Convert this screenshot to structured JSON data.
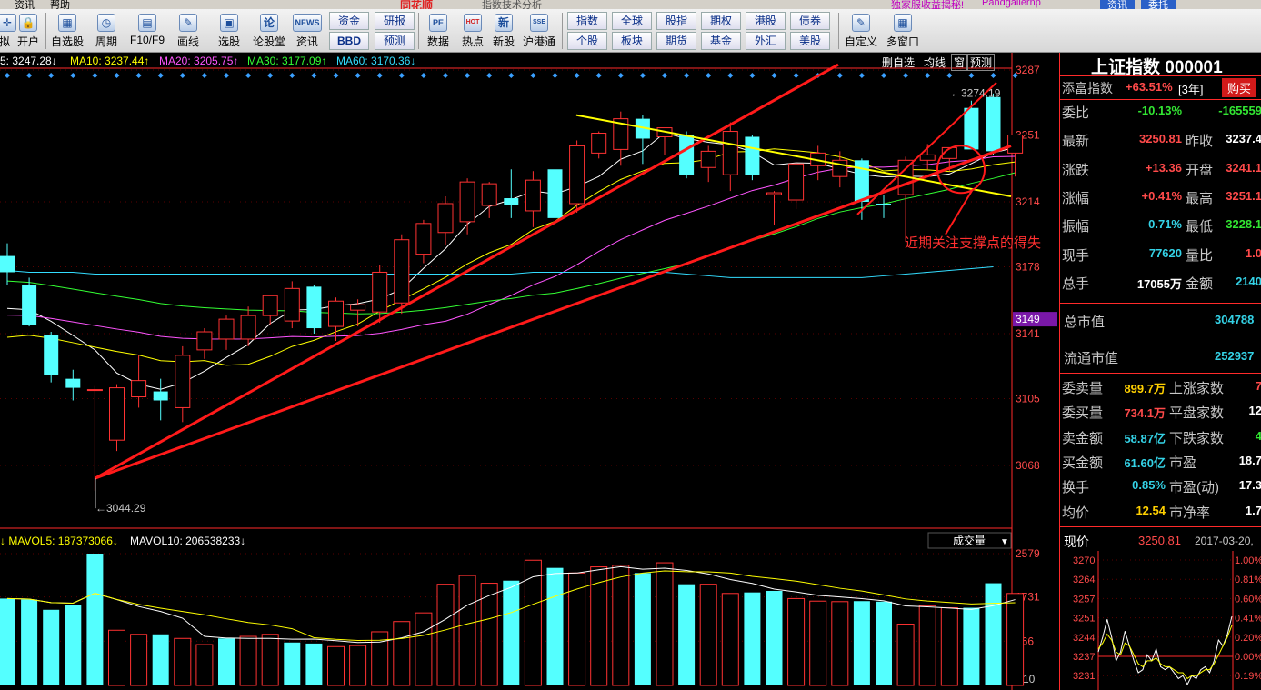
{
  "menubar": {
    "items": [
      "资讯",
      "帮助"
    ],
    "brand": "同花顺",
    "chart_type_label": "指数技术分析",
    "notice_left": "独家服收益揭秘!",
    "notice_right": "Pandgaiiernp",
    "tabs": [
      "资讯",
      "委托"
    ]
  },
  "toolbar": {
    "left": [
      {
        "label": "拟",
        "icon": "crosshair-icon",
        "glyph": "✛"
      },
      {
        "label": "开户",
        "icon": "lock-icon",
        "glyph": "🔒"
      },
      {
        "label": "自选股",
        "icon": "self-select-icon",
        "glyph": "▦"
      },
      {
        "label": "周期",
        "icon": "clock-icon",
        "glyph": "◷"
      },
      {
        "label": "F10/F9",
        "icon": "f10-icon",
        "glyph": "▤"
      },
      {
        "label": "画线",
        "icon": "pencil-icon",
        "glyph": "✎"
      },
      {
        "label": "选股",
        "icon": "stock-pick-icon",
        "glyph": "▣"
      },
      {
        "label": "论股堂",
        "icon": "forum-icon",
        "glyph": "论"
      },
      {
        "label": "资讯",
        "icon": "news-icon",
        "glyph": "NEWS"
      }
    ],
    "buttons_top": [
      "资金",
      "研报"
    ],
    "buttons_bottom": [
      "BBD",
      "预测"
    ],
    "mid": [
      {
        "label": "数据",
        "icon": "pe-icon",
        "glyph": "PE"
      },
      {
        "label": "热点",
        "icon": "hot-icon",
        "glyph": "HOT"
      },
      {
        "label": "新股",
        "icon": "new-stock-icon",
        "glyph": "新"
      },
      {
        "label": "沪港通",
        "icon": "sse-hkex-icon",
        "glyph": "SSE"
      }
    ],
    "market_top": [
      "指数",
      "全球",
      "股指",
      "期权",
      "港股",
      "债券"
    ],
    "market_bottom": [
      "个股",
      "板块",
      "期货",
      "基金",
      "外汇",
      "美股"
    ],
    "right": [
      {
        "label": "自定义",
        "icon": "custom-icon",
        "glyph": "✎"
      },
      {
        "label": "多窗口",
        "icon": "multi-window-icon",
        "glyph": "▦"
      }
    ]
  },
  "ma_bar": [
    {
      "text": "5: 3247.28↓",
      "color": "#ffffff"
    },
    {
      "text": "MA10: 3237.44↑",
      "color": "#ffff00"
    },
    {
      "text": "MA20: 3205.75↑",
      "color": "#ff55ff"
    },
    {
      "text": "MA30: 3177.09↑",
      "color": "#33ff33"
    },
    {
      "text": "MA60: 3170.36↓",
      "color": "#33ddff"
    }
  ],
  "chart_tabs": [
    "删自选",
    "均线",
    "窗",
    "预测"
  ],
  "chart_data": {
    "type": "candlestick",
    "price_axis": {
      "ticks": [
        "3287",
        "3251",
        "3214",
        "3178",
        "3141",
        "3105",
        "3068"
      ],
      "current": "3149"
    },
    "volume_axis": {
      "ticks": [
        "2579",
        "1731",
        "866"
      ],
      "unit": "X10"
    },
    "annotations": {
      "high": "3274.19",
      "low": "3044.29",
      "note": "近期关注支撑点的得失"
    },
    "candles": [
      {
        "o": 3184,
        "h": 3191,
        "l": 3168,
        "c": 3175
      },
      {
        "o": 3168,
        "h": 3172,
        "l": 3145,
        "c": 3146
      },
      {
        "o": 3140,
        "h": 3142,
        "l": 3114,
        "c": 3118
      },
      {
        "o": 3116,
        "h": 3121,
        "l": 3104,
        "c": 3111
      },
      {
        "o": 3110,
        "h": 3112,
        "l": 3054,
        "c": 3110
      },
      {
        "o": 3082,
        "h": 3113,
        "l": 3076,
        "c": 3111
      },
      {
        "o": 3106,
        "h": 3129,
        "l": 3100,
        "c": 3115
      },
      {
        "o": 3109,
        "h": 3116,
        "l": 3093,
        "c": 3104
      },
      {
        "o": 3100,
        "h": 3134,
        "l": 3092,
        "c": 3129
      },
      {
        "o": 3132,
        "h": 3144,
        "l": 3127,
        "c": 3142
      },
      {
        "o": 3138,
        "h": 3151,
        "l": 3132,
        "c": 3149
      },
      {
        "o": 3138,
        "h": 3156,
        "l": 3134,
        "c": 3151
      },
      {
        "o": 3151,
        "h": 3162,
        "l": 3146,
        "c": 3162
      },
      {
        "o": 3148,
        "h": 3170,
        "l": 3144,
        "c": 3166
      },
      {
        "o": 3167,
        "h": 3168,
        "l": 3141,
        "c": 3144
      },
      {
        "o": 3145,
        "h": 3161,
        "l": 3137,
        "c": 3159
      },
      {
        "o": 3154,
        "h": 3160,
        "l": 3145,
        "c": 3157
      },
      {
        "o": 3153,
        "h": 3179,
        "l": 3147,
        "c": 3175
      },
      {
        "o": 3158,
        "h": 3196,
        "l": 3152,
        "c": 3193
      },
      {
        "o": 3185,
        "h": 3204,
        "l": 3180,
        "c": 3202
      },
      {
        "o": 3197,
        "h": 3217,
        "l": 3190,
        "c": 3213
      },
      {
        "o": 3203,
        "h": 3227,
        "l": 3196,
        "c": 3225
      },
      {
        "o": 3212,
        "h": 3225,
        "l": 3205,
        "c": 3224
      },
      {
        "o": 3216,
        "h": 3232,
        "l": 3205,
        "c": 3212
      },
      {
        "o": 3209,
        "h": 3231,
        "l": 3200,
        "c": 3226
      },
      {
        "o": 3232,
        "h": 3234,
        "l": 3202,
        "c": 3205
      },
      {
        "o": 3213,
        "h": 3248,
        "l": 3208,
        "c": 3245
      },
      {
        "o": 3241,
        "h": 3253,
        "l": 3238,
        "c": 3252
      },
      {
        "o": 3243,
        "h": 3264,
        "l": 3234,
        "c": 3260
      },
      {
        "o": 3260,
        "h": 3262,
        "l": 3235,
        "c": 3249
      },
      {
        "o": 3250,
        "h": 3254,
        "l": 3240,
        "c": 3255
      },
      {
        "o": 3251,
        "h": 3253,
        "l": 3227,
        "c": 3229
      },
      {
        "o": 3233,
        "h": 3245,
        "l": 3225,
        "c": 3242
      },
      {
        "o": 3229,
        "h": 3258,
        "l": 3220,
        "c": 3253
      },
      {
        "o": 3250,
        "h": 3251,
        "l": 3226,
        "c": 3229
      },
      {
        "o": 3218,
        "h": 3220,
        "l": 3201,
        "c": 3219
      },
      {
        "o": 3215,
        "h": 3236,
        "l": 3210,
        "c": 3235
      },
      {
        "o": 3234,
        "h": 3245,
        "l": 3226,
        "c": 3241
      },
      {
        "o": 3228,
        "h": 3242,
        "l": 3222,
        "c": 3237
      },
      {
        "o": 3237,
        "h": 3238,
        "l": 3204,
        "c": 3214
      },
      {
        "o": 3213,
        "h": 3218,
        "l": 3205,
        "c": 3212
      },
      {
        "o": 3218,
        "h": 3239,
        "l": 3192,
        "c": 3237
      },
      {
        "o": 3237,
        "h": 3246,
        "l": 3232,
        "c": 3240
      },
      {
        "o": 3238,
        "h": 3244,
        "l": 3231,
        "c": 3244
      },
      {
        "o": 3266,
        "h": 3270,
        "l": 3244,
        "c": 3243
      },
      {
        "o": 3272,
        "h": 3274,
        "l": 3240,
        "c": 3242
      },
      {
        "o": 3241,
        "h": 3251,
        "l": 3228,
        "c": 3251
      }
    ],
    "volumes": [
      1700,
      1680,
      1480,
      1580,
      2579,
      1080,
      1000,
      1000,
      920,
      800,
      920,
      960,
      1000,
      840,
      820,
      760,
      780,
      1050,
      1250,
      1420,
      1980,
      2150,
      2000,
      2050,
      2450,
      2300,
      2200,
      2320,
      2350,
      2200,
      2400,
      1980,
      1980,
      1800,
      1820,
      1850,
      1700,
      1650,
      1640,
      1650,
      1640,
      1200,
      1560,
      1520,
      1520,
      2000,
      1800
    ],
    "volume_up_flags": [
      false,
      false,
      false,
      false,
      false,
      true,
      true,
      false,
      true,
      true,
      false,
      true,
      true,
      false,
      false,
      true,
      true,
      true,
      true,
      true,
      true,
      true,
      true,
      false,
      true,
      false,
      true,
      true,
      true,
      false,
      true,
      false,
      true,
      true,
      false,
      false,
      true,
      true,
      true,
      false,
      false,
      true,
      true,
      true,
      false,
      false,
      true
    ],
    "mavol": {
      "MAVOL5": "187373066",
      "MAVOL10": "206538233"
    },
    "volume_label": "成交量"
  },
  "right_panel": {
    "title": "上证指数 000001",
    "tianfu": {
      "label": "添富指数",
      "value": "+63.51%",
      "period": "[3年]",
      "buy": "购买"
    },
    "rows": [
      {
        "k1": "委比",
        "v1": "-10.13%",
        "c1": "grn",
        "k2": "",
        "v2": "-165559",
        "c2": "grn"
      },
      {
        "k1": "最新",
        "v1": "3250.81",
        "c1": "red",
        "k2": "昨收",
        "v2": "3237.4",
        "c2": "wh"
      },
      {
        "k1": "涨跌",
        "v1": "+13.36",
        "c1": "red",
        "k2": "开盘",
        "v2": "3241.1",
        "c2": "red"
      },
      {
        "k1": "涨幅",
        "v1": "+0.41%",
        "c1": "red",
        "k2": "最高",
        "v2": "3251.1",
        "c2": "red"
      },
      {
        "k1": "振幅",
        "v1": "0.71%",
        "c1": "cy",
        "k2": "最低",
        "v2": "3228.1",
        "c2": "grn"
      },
      {
        "k1": "现手",
        "v1": "77620",
        "c1": "cy",
        "k2": "量比",
        "v2": "1.0",
        "c2": "red"
      },
      {
        "k1": "总手",
        "v1": "17055万",
        "c1": "wh",
        "k2": "金额",
        "v2": "2140",
        "c2": "cy"
      }
    ],
    "total_cap": {
      "label": "总市值",
      "value": "304788"
    },
    "float_cap": {
      "label": "流通市值",
      "value": "252937"
    },
    "stats": [
      {
        "k1": "委卖量",
        "v1": "899.7万",
        "c1": "yl",
        "k2": "上涨家数",
        "v2": "7",
        "c2": "red"
      },
      {
        "k1": "委买量",
        "v1": "734.1万",
        "c1": "red",
        "k2": "平盘家数",
        "v2": "12",
        "c2": "wh"
      },
      {
        "k1": "卖金额",
        "v1": "58.87亿",
        "c1": "cy",
        "k2": "下跌家数",
        "v2": "4",
        "c2": "grn"
      },
      {
        "k1": "买金额",
        "v1": "61.60亿",
        "c1": "cy",
        "k2": "市盈",
        "v2": "18.7",
        "c2": "wh"
      },
      {
        "k1": "换手",
        "v1": "0.85%",
        "c1": "cy",
        "k2": "市盈(动)",
        "v2": "17.3",
        "c2": "wh"
      },
      {
        "k1": "均价",
        "v1": "12.54",
        "c1": "yl",
        "k2": "市净率",
        "v2": "1.7",
        "c2": "wh"
      }
    ],
    "mini": {
      "label": "现价",
      "price": "3250.81",
      "date": "2017-03-20,",
      "prices": [
        "3270",
        "3264",
        "3257",
        "3251",
        "3244",
        "3237",
        "3231"
      ],
      "pcts": [
        "1.00%",
        "0.81%",
        "0.60%",
        "0.41%",
        "0.20%",
        "0.00%",
        "0.19%"
      ]
    }
  },
  "colors": {
    "up": "#ff3232",
    "down": "#54ffff",
    "ma5": "#ffffff",
    "ma10": "#ffff00",
    "ma20": "#ff55ff",
    "ma30": "#33ff33",
    "ma60": "#33ddff",
    "trendline": "#ff1a1a",
    "resistance": "#ffff00"
  }
}
